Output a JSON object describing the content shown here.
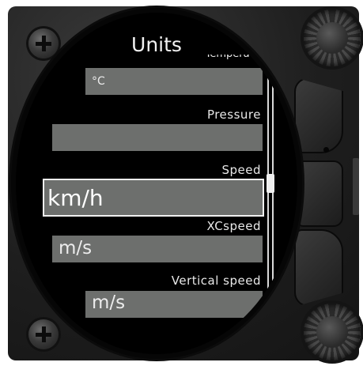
{
  "screen": {
    "title": "Units",
    "partial_label": "Temperature"
  },
  "fields": [
    {
      "id": "temperature",
      "label": "",
      "value": "°C"
    },
    {
      "id": "pressure",
      "label": "Pressure",
      "value": ""
    },
    {
      "id": "speed",
      "label": "Speed",
      "value": "km/h"
    },
    {
      "id": "xcspeed",
      "label": "XCspeed",
      "value": "m/s"
    },
    {
      "id": "vertical_speed",
      "label": "Vertical speed",
      "value": "m/s"
    }
  ],
  "colors": {
    "field_bg": "#6d6f6d",
    "text": "#ececec",
    "focus_border": "#f0f0f0"
  }
}
